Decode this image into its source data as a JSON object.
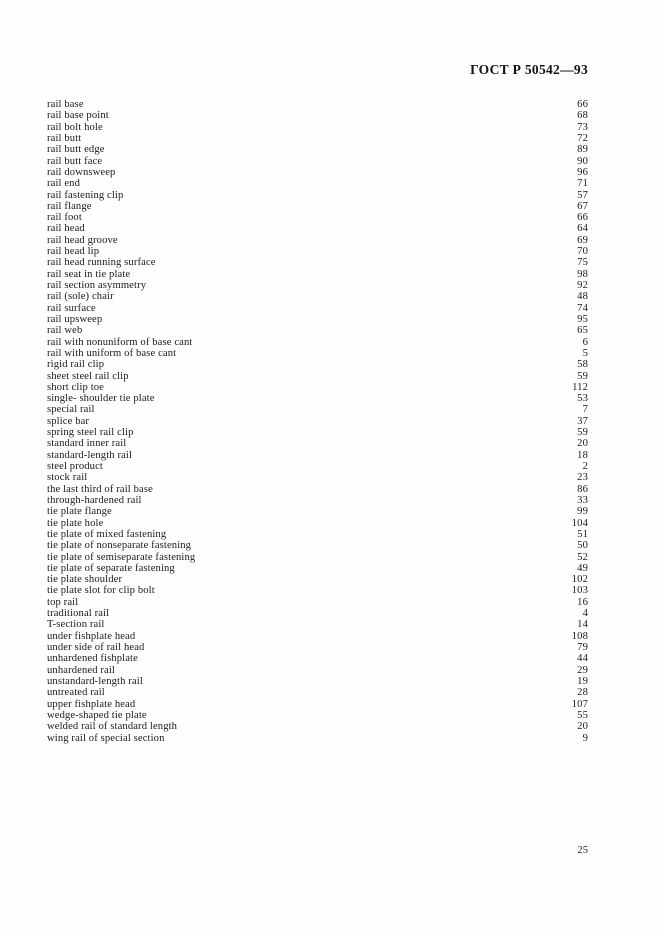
{
  "document": {
    "standard_header": "ГОСТ Р 50542—93",
    "page_number": "25"
  },
  "index": {
    "entries": [
      {
        "term": "rail base",
        "page": "66"
      },
      {
        "term": "rail base point",
        "page": "68"
      },
      {
        "term": "rail bolt hole",
        "page": "73"
      },
      {
        "term": "rail butt",
        "page": "72"
      },
      {
        "term": "rail butt edge",
        "page": "89"
      },
      {
        "term": "rail butt face",
        "page": "90"
      },
      {
        "term": "rail downsweep",
        "page": "96"
      },
      {
        "term": "rail end",
        "page": "71"
      },
      {
        "term": "rail fastening clip",
        "page": "57"
      },
      {
        "term": "rail flange",
        "page": "67"
      },
      {
        "term": "rail foot",
        "page": "66"
      },
      {
        "term": "rail head",
        "page": "64"
      },
      {
        "term": "rail head groove",
        "page": "69"
      },
      {
        "term": "rail head lip",
        "page": "70"
      },
      {
        "term": "rail head running surface",
        "page": "75"
      },
      {
        "term": "rail seat in tie plate",
        "page": "98"
      },
      {
        "term": "rail section asymmetry",
        "page": "92"
      },
      {
        "term": "rail (sole) chair",
        "page": "48"
      },
      {
        "term": "rail surface",
        "page": "74"
      },
      {
        "term": "rail upsweep",
        "page": "95"
      },
      {
        "term": "rail web",
        "page": "65"
      },
      {
        "term": "rail with nonuniform of base cant",
        "page": "6"
      },
      {
        "term": "rail with uniform of base cant",
        "page": "5"
      },
      {
        "term": "rigid rail clip",
        "page": "58"
      },
      {
        "term": "sheet steel rail clip",
        "page": "59"
      },
      {
        "term": "short clip toe",
        "page": "112"
      },
      {
        "term": "single- shoulder tie plate",
        "page": "53"
      },
      {
        "term": "special rail",
        "page": "7"
      },
      {
        "term": "splice bar",
        "page": "37"
      },
      {
        "term": "spring steel rail clip",
        "page": "59"
      },
      {
        "term": "standard inner rail",
        "page": "20"
      },
      {
        "term": "standard-length rail",
        "page": "18"
      },
      {
        "term": "steel product",
        "page": "2"
      },
      {
        "term": "stock rail",
        "page": "23"
      },
      {
        "term": "the last third of rail base",
        "page": "86"
      },
      {
        "term": "through-hardened rail",
        "page": "33"
      },
      {
        "term": "tie plate flange",
        "page": "99"
      },
      {
        "term": "tie plate hole",
        "page": "104"
      },
      {
        "term": "tie plate of mixed fastening",
        "page": "51"
      },
      {
        "term": "tie plate of nonseparate fastening",
        "page": "50"
      },
      {
        "term": "tie plate of semiseparate fastening",
        "page": "52"
      },
      {
        "term": "tie plate of separate fastening",
        "page": "49"
      },
      {
        "term": "tie plate shoulder",
        "page": "102"
      },
      {
        "term": "tie plate slot for clip bolt",
        "page": "103"
      },
      {
        "term": "top rail",
        "page": "16"
      },
      {
        "term": "traditional rail",
        "page": "4"
      },
      {
        "term": "T-section rail",
        "page": "14"
      },
      {
        "term": "under fishplate head",
        "page": "108"
      },
      {
        "term": "under side of rail head",
        "page": "79"
      },
      {
        "term": "unhardened fishplate",
        "page": "44"
      },
      {
        "term": "unhardened rail",
        "page": "29"
      },
      {
        "term": "unstandard-length rail",
        "page": "19"
      },
      {
        "term": "untreated rail",
        "page": "28"
      },
      {
        "term": "upper fishplate head",
        "page": "107"
      },
      {
        "term": "wedge-shaped tie plate",
        "page": "55"
      },
      {
        "term": "welded rail of standard length",
        "page": "20"
      },
      {
        "term": "wing rail of special section",
        "page": "9"
      }
    ]
  }
}
